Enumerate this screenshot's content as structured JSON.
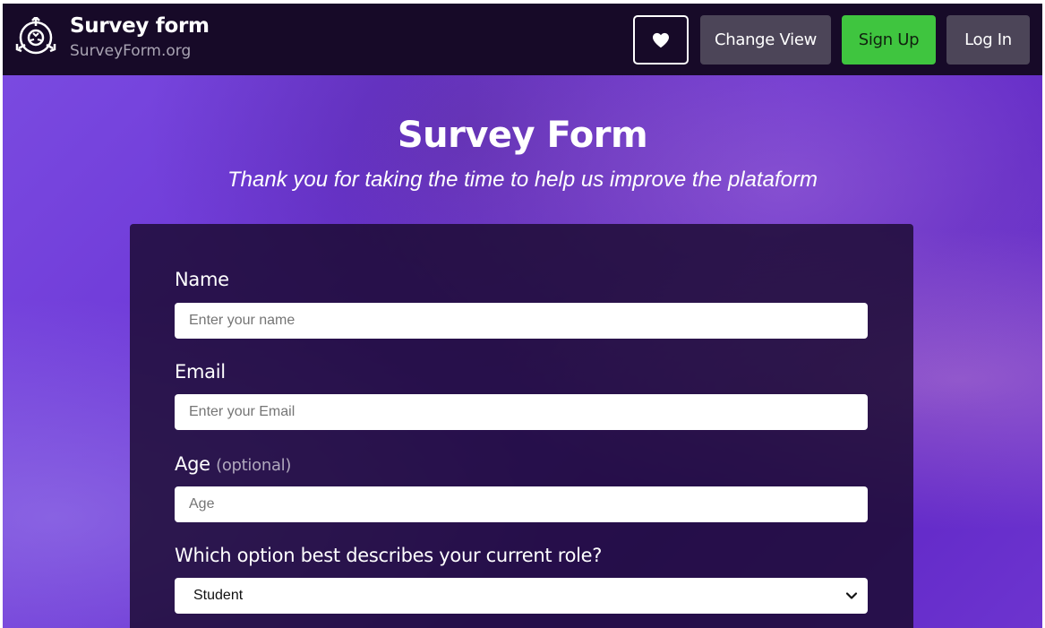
{
  "header": {
    "title": "Survey form",
    "subtitle": "SurveyForm.org",
    "buttons": {
      "favorite_icon": "heart-icon",
      "change_view": "Change View",
      "sign_up": "Sign Up",
      "log_in": "Log In"
    }
  },
  "hero": {
    "title": "Survey Form",
    "subtitle": "Thank you for taking the time to help us improve the plataform"
  },
  "form": {
    "name": {
      "label": "Name",
      "placeholder": "Enter your name"
    },
    "email": {
      "label": "Email",
      "placeholder": "Enter your Email"
    },
    "age": {
      "label": "Age",
      "optional": "(optional)",
      "placeholder": "Age"
    },
    "role": {
      "label": "Which option best describes your current role?",
      "selected": "Student"
    }
  },
  "colors": {
    "navbar": "#170a28",
    "accent_green": "#3fc53f",
    "button_gray": "#4c4558",
    "hero_purple": "#6a32d4",
    "card": "#1a0a2e"
  }
}
